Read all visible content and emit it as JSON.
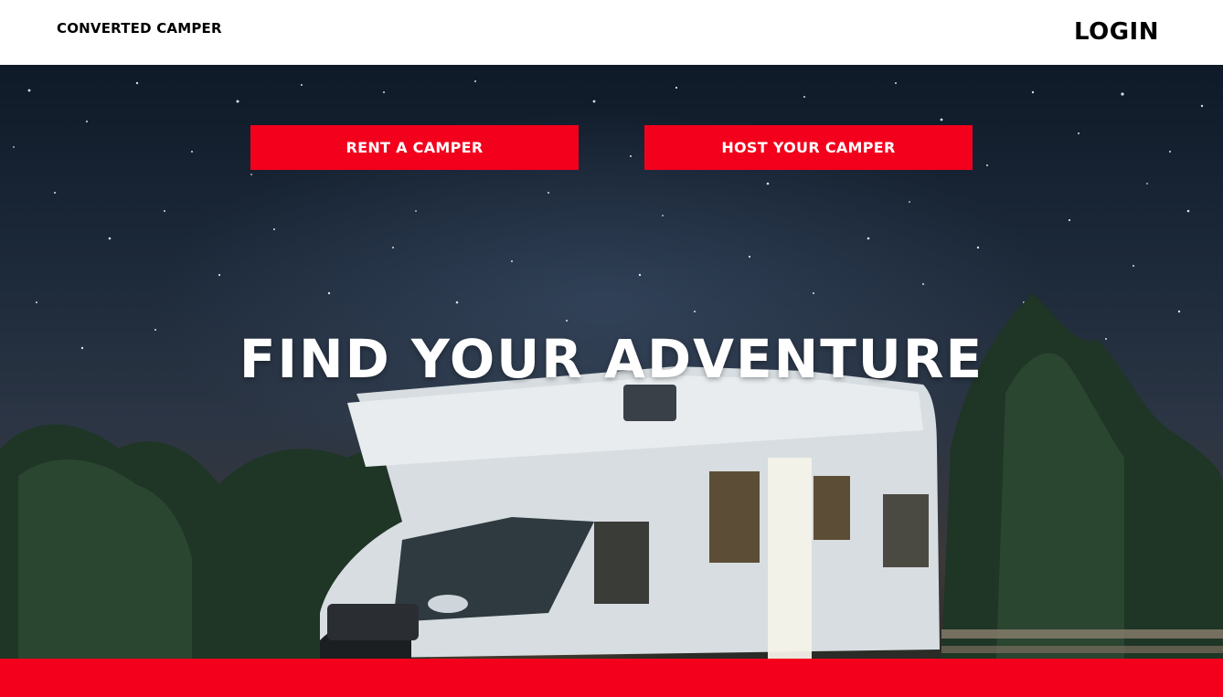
{
  "header": {
    "brand": "CONVERTED CAMPER",
    "login_label": "LOGIN"
  },
  "hero": {
    "rent_label": "RENT A CAMPER",
    "host_label": "HOST YOUR CAMPER",
    "headline": "FIND YOUR ADVENTURE",
    "image_subject": "camper van under starry night sky"
  },
  "colors": {
    "accent": "#f3001c",
    "text_dark": "#000000",
    "text_light": "#ffffff"
  }
}
